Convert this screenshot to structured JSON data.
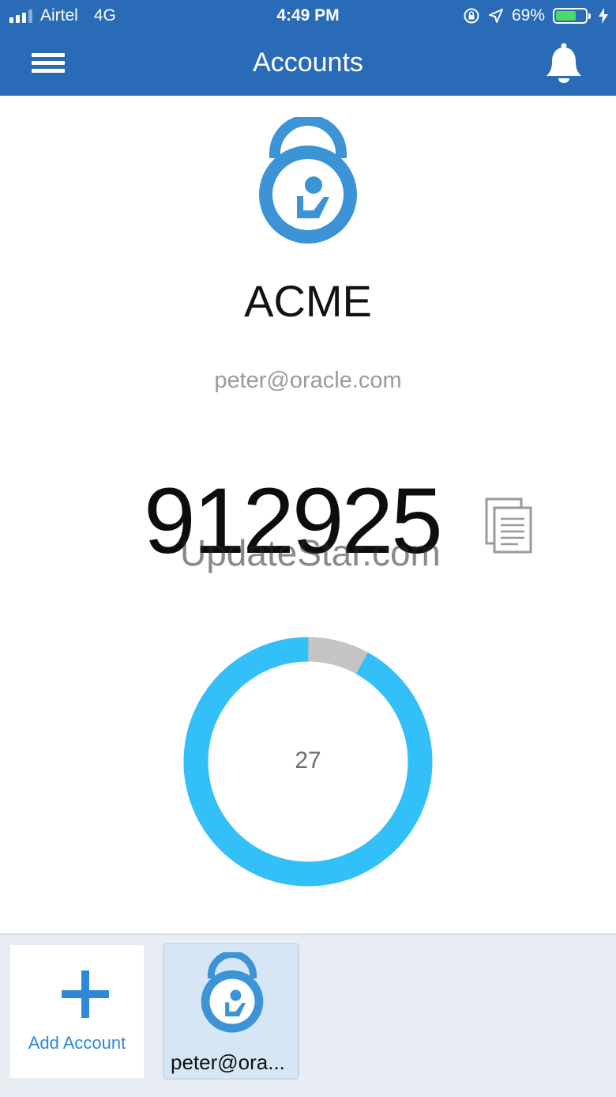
{
  "status_bar": {
    "carrier": "Airtel",
    "network": "4G",
    "time": "4:49 PM",
    "battery_percent": "69%",
    "battery_level": 0.69,
    "icons": [
      "signal-icon",
      "orientation-lock-icon",
      "location-arrow-icon",
      "battery-icon",
      "charging-bolt-icon"
    ]
  },
  "header": {
    "title": "Accounts",
    "menu_icon": "hamburger-menu-icon",
    "notification_icon": "bell-icon"
  },
  "account": {
    "issuer": "ACME",
    "email": "peter@oracle.com",
    "code": "912925",
    "watermark": "UpdateStar.com",
    "copy_icon": "copy-icon"
  },
  "timer": {
    "seconds_remaining": "27",
    "remaining_fraction": 0.92,
    "ring_color": "#33c0f8",
    "elapsed_color": "#c4c4c4"
  },
  "tray": {
    "add_label": "Add Account",
    "accounts": [
      {
        "label": "peter@ora..."
      }
    ]
  },
  "colors": {
    "header_bg": "#2a6bb8",
    "brand_blue": "#3c93d6",
    "accent_blue": "#2e88d8"
  }
}
